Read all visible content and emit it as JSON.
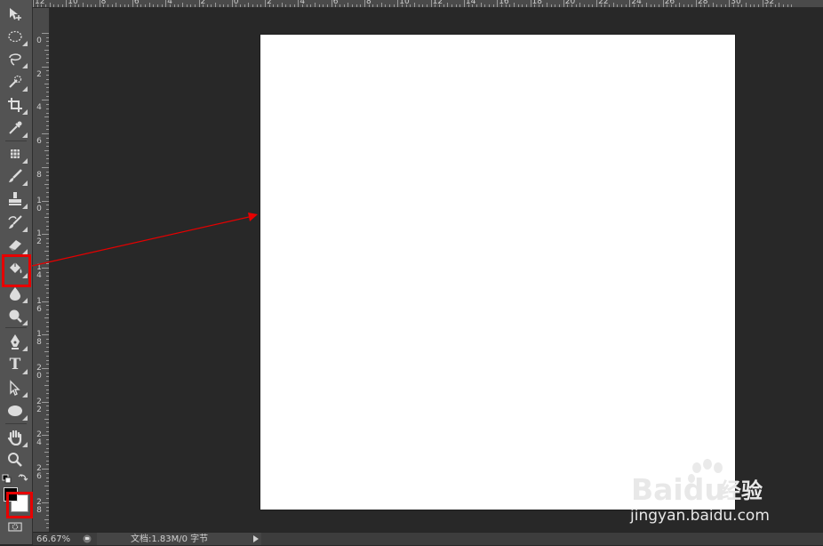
{
  "toolbar": {
    "tools": [
      {
        "id": "move",
        "icon": "move-icon"
      },
      {
        "id": "marquee",
        "icon": "ellipse-marquee-icon"
      },
      {
        "id": "lasso",
        "icon": "lasso-icon"
      },
      {
        "id": "quick-select",
        "icon": "quick-selection-icon"
      },
      {
        "id": "crop",
        "icon": "crop-icon"
      },
      {
        "id": "eyedropper",
        "icon": "eyedropper-icon"
      },
      {
        "id": "healing",
        "icon": "spot-healing-icon"
      },
      {
        "id": "brush",
        "icon": "brush-icon"
      },
      {
        "id": "stamp",
        "icon": "clone-stamp-icon"
      },
      {
        "id": "history-brush",
        "icon": "history-brush-icon"
      },
      {
        "id": "eraser",
        "icon": "eraser-icon"
      },
      {
        "id": "paint-bucket",
        "icon": "paint-bucket-icon",
        "highlighted": true
      },
      {
        "id": "blur",
        "icon": "blur-drop-icon"
      },
      {
        "id": "dodge",
        "icon": "dodge-icon"
      },
      {
        "id": "pen",
        "icon": "pen-icon"
      },
      {
        "id": "type",
        "icon": "type-icon",
        "label": "T"
      },
      {
        "id": "path-select",
        "icon": "path-selection-icon"
      },
      {
        "id": "ellipse",
        "icon": "ellipse-shape-icon"
      },
      {
        "id": "hand",
        "icon": "hand-icon"
      },
      {
        "id": "zoom",
        "icon": "zoom-icon"
      }
    ],
    "foreground_color": "#000000",
    "background_color": "#ffffff",
    "highlight_color": "#e60000"
  },
  "rulers": {
    "top_labels": [
      "12",
      "10",
      "8",
      "6",
      "4",
      "2",
      "0",
      "2",
      "4",
      "6",
      "8",
      "10",
      "12",
      "14",
      "16",
      "18",
      "20",
      "22",
      "24",
      "26",
      "28",
      "30",
      "32"
    ],
    "left_labels": [
      "0",
      "2",
      "4",
      "6",
      "8",
      "10",
      "12",
      "14",
      "16",
      "18",
      "20",
      "22",
      "24",
      "26",
      "28"
    ]
  },
  "canvas": {
    "background": "#ffffff"
  },
  "annotation": {
    "arrow_color": "#e60000"
  },
  "watermark": {
    "brand": "Baidu",
    "brand_cn": "经验",
    "url": "jingyan.baidu.com"
  },
  "status": {
    "zoom": "66.67%",
    "doc_info": "文档:1.83M/0 字节"
  }
}
